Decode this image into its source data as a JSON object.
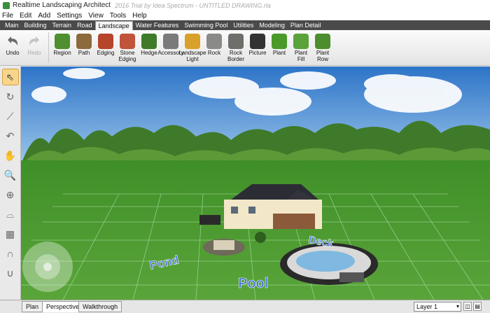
{
  "window": {
    "title": "Realtime Landscaping Architect",
    "title_extra": "2016 Trial by Idea Spectrum - UNTITLED DRAWING.rla"
  },
  "menu": [
    "File",
    "Edit",
    "Add",
    "Settings",
    "View",
    "Tools",
    "Help"
  ],
  "tabs": [
    "Main",
    "Building",
    "Terrain",
    "Road",
    "Landscape",
    "Water Features",
    "Swimming Pool",
    "Utilities",
    "Modeling",
    "Plan Detail"
  ],
  "active_tab": "Landscape",
  "ribbon": {
    "undo": "Undo",
    "redo": "Redo",
    "tools": [
      {
        "label": "Region",
        "icon": "region-icon",
        "color": "#4f8f2f"
      },
      {
        "label": "Path",
        "icon": "path-icon",
        "color": "#8c6a3c"
      },
      {
        "label": "Edging",
        "icon": "edging-icon",
        "color": "#b5452b"
      },
      {
        "label": "Stone Edging",
        "icon": "stone-edging-icon",
        "color": "#c0533a"
      },
      {
        "label": "Hedge",
        "icon": "hedge-icon",
        "color": "#3e7a27"
      },
      {
        "label": "Accessory",
        "icon": "accessory-icon",
        "color": "#7a7a7a"
      },
      {
        "label": "Landscape Light",
        "icon": "landscape-light-icon",
        "color": "#d9a12a"
      },
      {
        "label": "Rock",
        "icon": "rock-icon",
        "color": "#8a8a88"
      },
      {
        "label": "Rock Border",
        "icon": "rock-border-icon",
        "color": "#6e6e6a"
      },
      {
        "label": "Picture",
        "icon": "camera-icon",
        "color": "#333333"
      },
      {
        "label": "Plant",
        "icon": "plant-icon",
        "color": "#4a9a2a"
      },
      {
        "label": "Plant Fill",
        "icon": "plant-fill-icon",
        "color": "#5aa23a"
      },
      {
        "label": "Plant Row",
        "icon": "plant-row-icon",
        "color": "#4c8e2e"
      }
    ]
  },
  "left_tools": [
    {
      "name": "select-tool",
      "glyph": "⇖"
    },
    {
      "name": "rotate-tool",
      "glyph": "↻"
    },
    {
      "name": "measure-tool",
      "glyph": "⟋"
    },
    {
      "name": "curve-tool",
      "glyph": "↶"
    },
    {
      "name": "hand-tool",
      "glyph": "✋"
    },
    {
      "name": "zoom-tool",
      "glyph": "🔍"
    },
    {
      "name": "zoom-extents-tool",
      "glyph": "⊕"
    },
    {
      "name": "orbit-tool",
      "glyph": "⌓"
    },
    {
      "name": "grid-tool",
      "glyph": "▦"
    },
    {
      "name": "magnet-tool",
      "glyph": "∩"
    },
    {
      "name": "snap-tool",
      "glyph": "∪"
    }
  ],
  "scene_labels": {
    "pond": "Pond",
    "deck": "Deck",
    "pool": "Pool"
  },
  "view_tabs": [
    "Plan",
    "Perspective",
    "Walkthrough"
  ],
  "active_view": "Perspective",
  "layer": "Layer 1"
}
